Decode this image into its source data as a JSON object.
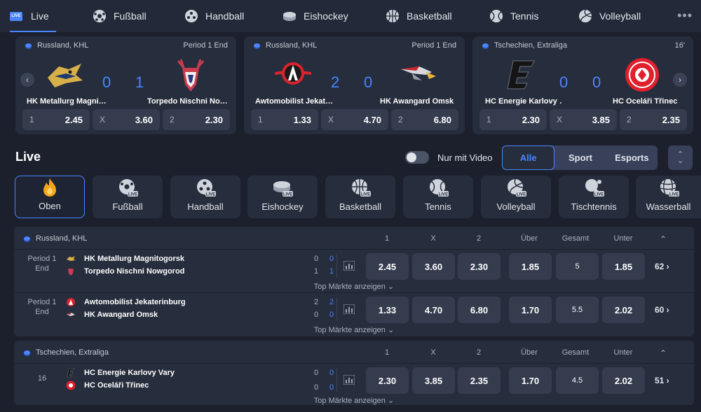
{
  "nav": {
    "live_badge": "LIVE",
    "live_label": "Live",
    "items": [
      "Fußball",
      "Handball",
      "Eishockey",
      "Basketball",
      "Tennis",
      "Volleyball"
    ],
    "more": "•••"
  },
  "cards": [
    {
      "league": "Russland, KHL",
      "status": "Period 1 End",
      "home": "HK Metallurg Magni…",
      "away": "Torpedo Nischni No…",
      "score_home": "0",
      "score_away": "1",
      "odds": [
        {
          "k": "1",
          "v": "2.45"
        },
        {
          "k": "X",
          "v": "3.60"
        },
        {
          "k": "2",
          "v": "2.30"
        }
      ]
    },
    {
      "league": "Russland, KHL",
      "status": "Period 1 End",
      "home": "Awtomobilist Jekat…",
      "away": "HK Awangard Omsk",
      "score_home": "2",
      "score_away": "0",
      "odds": [
        {
          "k": "1",
          "v": "1.33"
        },
        {
          "k": "X",
          "v": "4.70"
        },
        {
          "k": "2",
          "v": "6.80"
        }
      ]
    },
    {
      "league": "Tschechien, Extraliga",
      "status": "16'",
      "home": "HC Energie Karlovy …",
      "away": "HC Oceláři Třinec",
      "score_home": "0",
      "score_away": "0",
      "odds": [
        {
          "k": "1",
          "v": "2.30"
        },
        {
          "k": "X",
          "v": "3.85"
        },
        {
          "k": "2",
          "v": "2.35"
        }
      ]
    }
  ],
  "live": {
    "title": "Live",
    "video_label": "Nur mit Video",
    "segments": [
      "Alle",
      "Sport",
      "Esports"
    ]
  },
  "categories": [
    {
      "label": "Oben"
    },
    {
      "label": "Fußball"
    },
    {
      "label": "Handball"
    },
    {
      "label": "Eishockey"
    },
    {
      "label": "Basketball"
    },
    {
      "label": "Tennis"
    },
    {
      "label": "Volleyball"
    },
    {
      "label": "Tischtennis"
    },
    {
      "label": "Wasserball"
    }
  ],
  "live_badge_small": "LIVE",
  "headers": [
    "1",
    "X",
    "2",
    "Über",
    "Gesamt",
    "Unter"
  ],
  "groups": [
    {
      "league": "Russland, KHL",
      "matches": [
        {
          "period1": "Period 1",
          "period2": "End",
          "home": "HK Metallurg Magnitogorsk",
          "away": "Torpedo Nischni Nowgorod",
          "total_home": "0",
          "total_away": "1",
          "p_home": "0",
          "p_away": "1",
          "o1": "2.45",
          "ox": "3.60",
          "o2": "2.30",
          "over": "1.85",
          "total": "5",
          "under": "1.85",
          "more": "62 ›",
          "top": "Top Märkte anzeigen ⌄"
        },
        {
          "period1": "Period 1",
          "period2": "End",
          "home": "Awtomobilist Jekaterinburg",
          "away": "HK Awangard Omsk",
          "total_home": "2",
          "total_away": "0",
          "p_home": "2",
          "p_away": "0",
          "o1": "1.33",
          "ox": "4.70",
          "o2": "6.80",
          "over": "1.70",
          "total": "5.5",
          "under": "2.02",
          "more": "60 ›",
          "top": "Top Märkte anzeigen ⌄"
        }
      ]
    },
    {
      "league": "Tschechien, Extraliga",
      "matches": [
        {
          "period1": "16",
          "period2": "",
          "home": "HC Energie Karlovy Vary",
          "away": "HC Oceláři Třinec",
          "total_home": "0",
          "total_away": "0",
          "p_home": "0",
          "p_away": "0",
          "o1": "2.30",
          "ox": "3.85",
          "o2": "2.35",
          "over": "1.70",
          "total": "4.5",
          "under": "2.02",
          "more": "51 ›",
          "top": "Top Märkte anzeigen ⌄"
        }
      ]
    }
  ]
}
